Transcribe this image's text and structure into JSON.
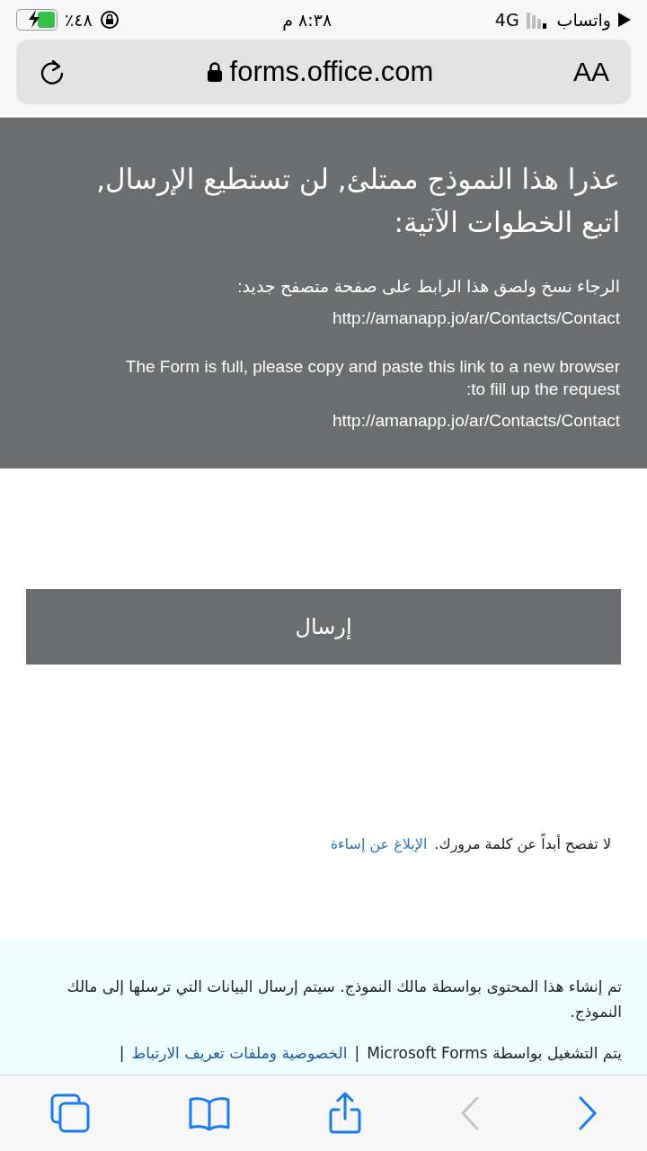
{
  "status_bar": {
    "back_app": "واتساب",
    "network": "4G",
    "time": "٨:٣٨ م",
    "battery": "٪٤٨",
    "level": 0.48
  },
  "address_bar": {
    "text_size": "AA",
    "url": "forms.office.com"
  },
  "banner": {
    "title": "عذرا هذا النموذج ممتلئ, لن تستطيع الإرسال, اتبع الخطوات الآتية:",
    "paragraphs": [
      {
        "lines": [
          "الرجاء نسخ ولصق هذا الرابط على صفحة متصفح جديد:",
          "http://amanapp.jo/ar/Contacts/Contact"
        ]
      },
      {
        "lines": [
          "The Form is full, please copy and paste this link to a new browser to fill up the request:",
          "http://amanapp.jo/ar/Contacts/Contact"
        ]
      }
    ]
  },
  "submit_button": "إرسال",
  "password_notice": {
    "text": "لا تفصح أبداً عن كلمة مرورك.",
    "link": "الإبلاغ عن إساءة"
  },
  "footer": {
    "notice": "تم إنشاء هذا المحتوى بواسطة مالك النموذج. سيتم إرسال البيانات التي ترسلها إلى مالك النموذج.",
    "powered_by": "يتم التشغيل بواسطة Microsoft Forms",
    "separator_1": "|",
    "privacy_link": "الخصوصية وملفات تعريف الارتباط",
    "separator_2": "|"
  },
  "toolbar": {
    "back_disabled": true,
    "forward_disabled": false
  }
}
